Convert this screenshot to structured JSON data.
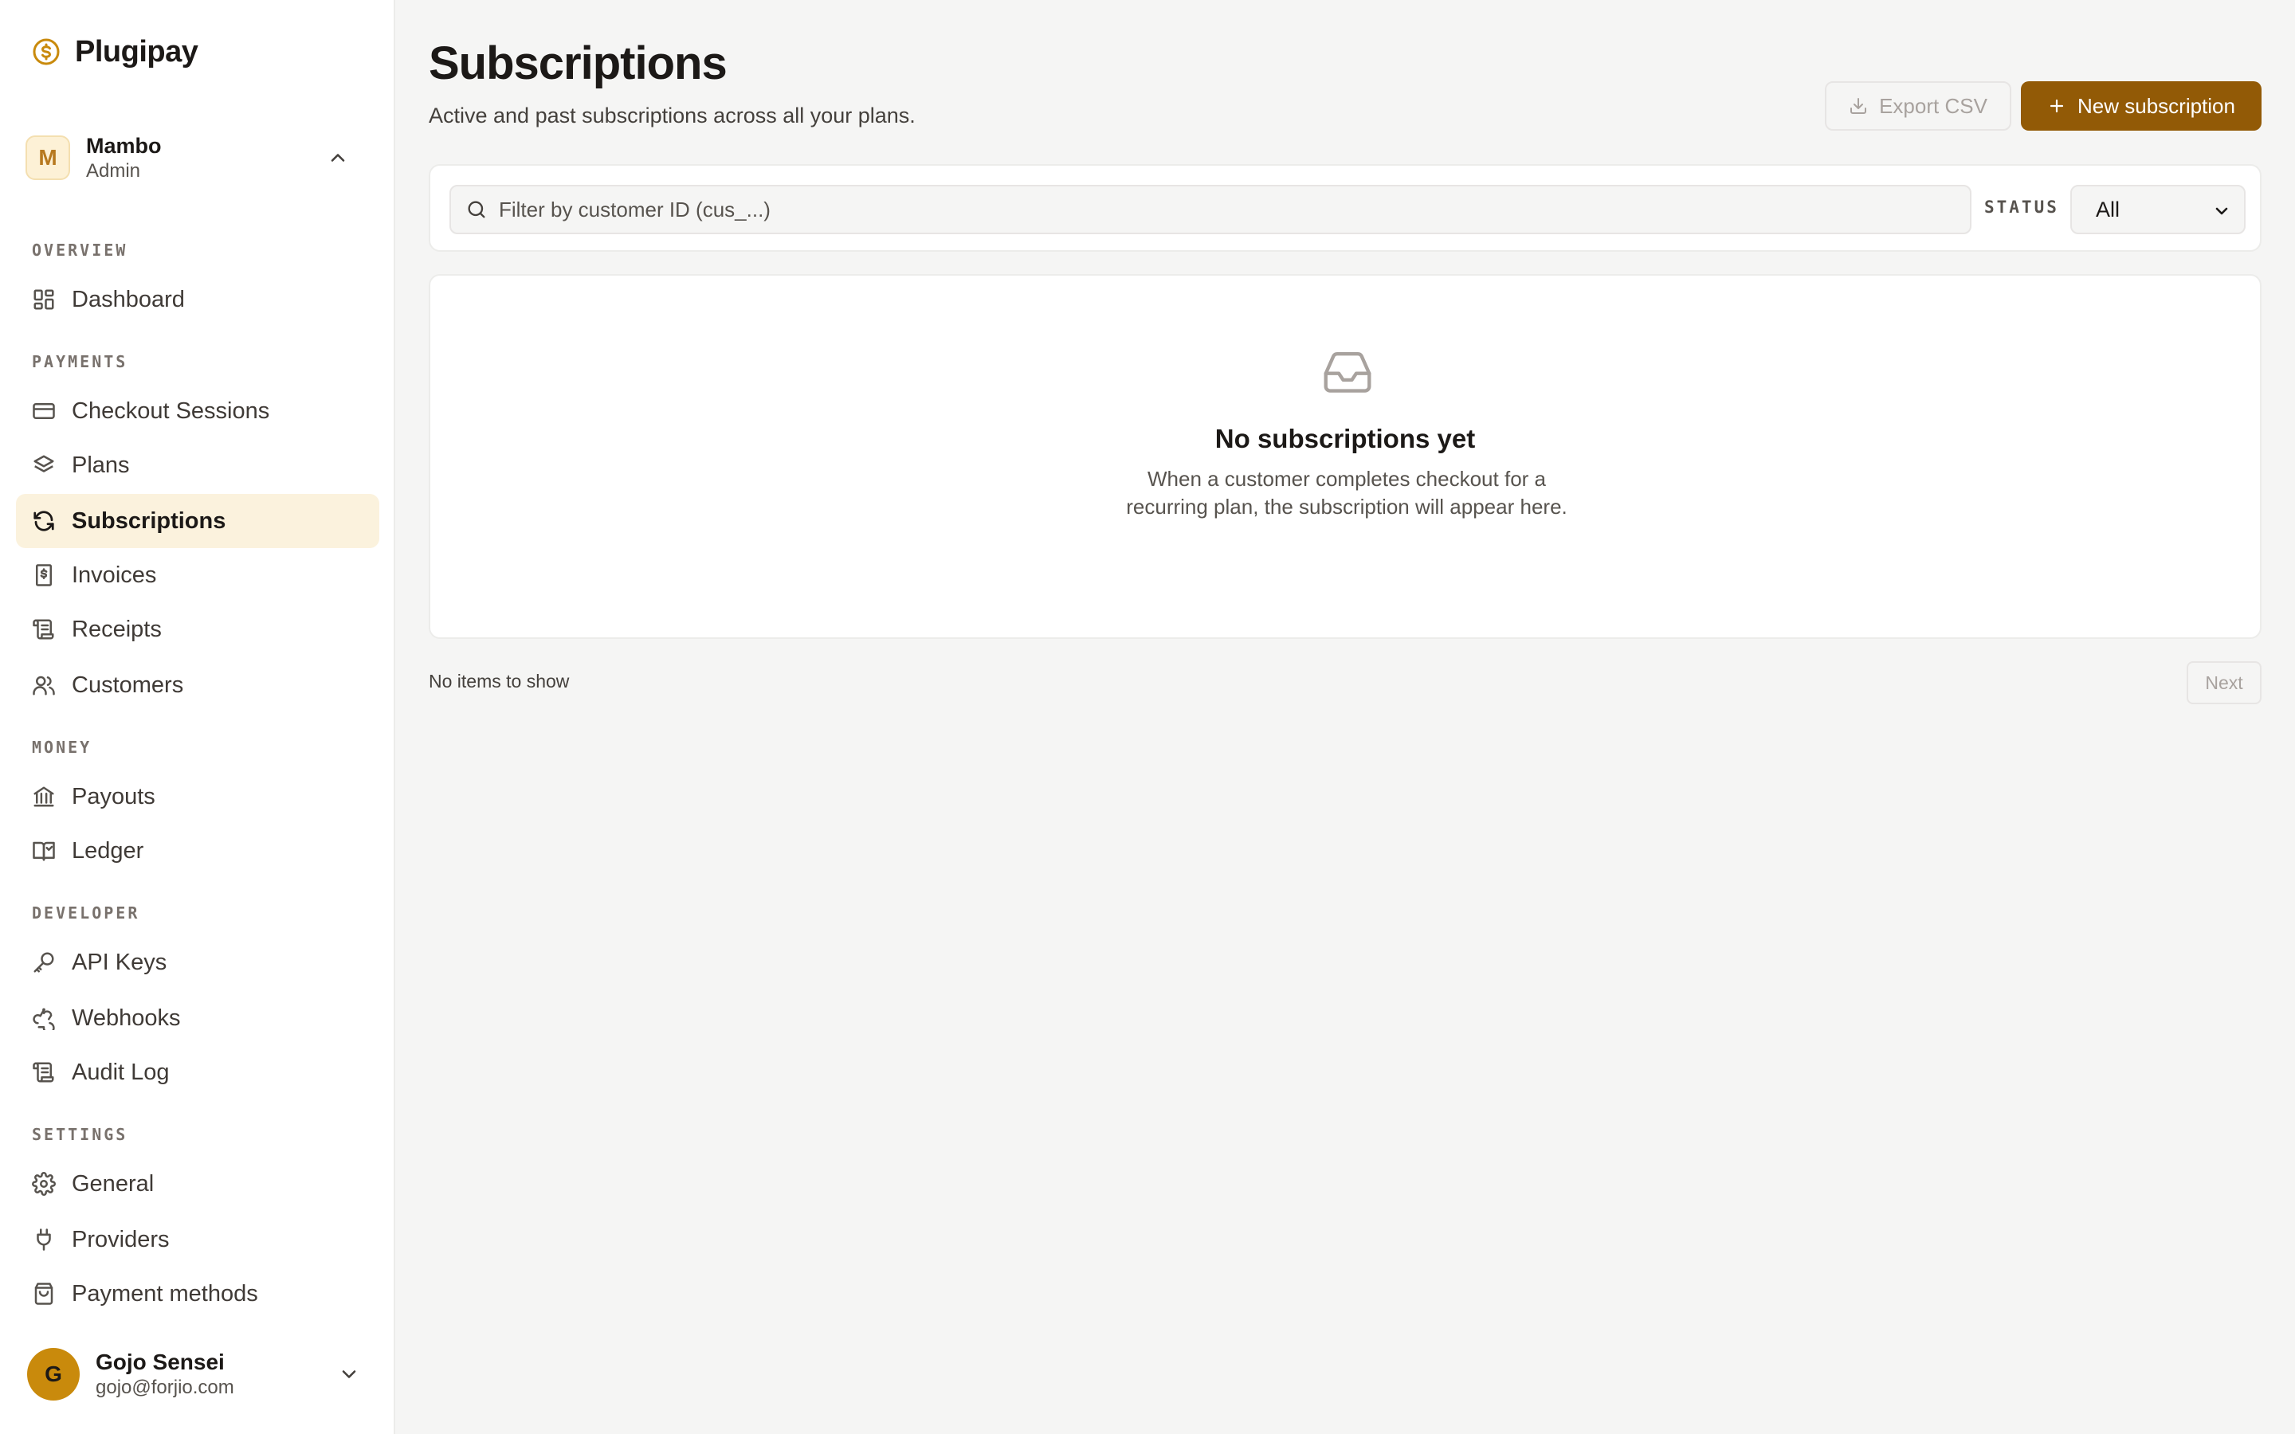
{
  "brand": {
    "name": "Plugipay",
    "logo_icon": "dollar-coin-icon",
    "accent": "#c98a0c"
  },
  "org": {
    "initial": "M",
    "name": "Mambo",
    "role": "Admin"
  },
  "sidebar": {
    "sections": [
      {
        "title": "OVERVIEW",
        "items": [
          {
            "label": "Dashboard",
            "icon": "dashboard-icon"
          }
        ]
      },
      {
        "title": "PAYMENTS",
        "items": [
          {
            "label": "Checkout Sessions",
            "icon": "credit-card-icon"
          },
          {
            "label": "Plans",
            "icon": "layers-icon"
          },
          {
            "label": "Subscriptions",
            "icon": "refresh-icon",
            "active": true
          },
          {
            "label": "Invoices",
            "icon": "invoice-icon"
          },
          {
            "label": "Receipts",
            "icon": "receipt-icon"
          },
          {
            "label": "Customers",
            "icon": "users-icon"
          }
        ]
      },
      {
        "title": "MONEY",
        "items": [
          {
            "label": "Payouts",
            "icon": "bank-icon"
          },
          {
            "label": "Ledger",
            "icon": "book-open-icon"
          }
        ]
      },
      {
        "title": "DEVELOPER",
        "items": [
          {
            "label": "API Keys",
            "icon": "key-icon"
          },
          {
            "label": "Webhooks",
            "icon": "webhook-icon"
          },
          {
            "label": "Audit Log",
            "icon": "scroll-icon"
          }
        ]
      },
      {
        "title": "SETTINGS",
        "items": [
          {
            "label": "General",
            "icon": "gear-icon"
          },
          {
            "label": "Providers",
            "icon": "plug-icon"
          },
          {
            "label": "Payment methods",
            "icon": "wallet-icon"
          }
        ]
      }
    ]
  },
  "user": {
    "initial": "G",
    "name": "Gojo Sensei",
    "email": "gojo@forjio.com"
  },
  "header": {
    "title": "Subscriptions",
    "subtitle": "Active and past subscriptions across all your plans.",
    "export_label": "Export CSV",
    "new_label": "New subscription",
    "primary_color": "#925a06"
  },
  "filters": {
    "search_placeholder": "Filter by customer ID (cus_...)",
    "status_label": "STATUS",
    "status_value": "All"
  },
  "empty_state": {
    "icon": "inbox-icon",
    "title": "No subscriptions yet",
    "description": "When a customer completes checkout for a recurring plan, the subscription will appear here."
  },
  "pagination": {
    "summary": "No items to show",
    "next_label": "Next"
  }
}
